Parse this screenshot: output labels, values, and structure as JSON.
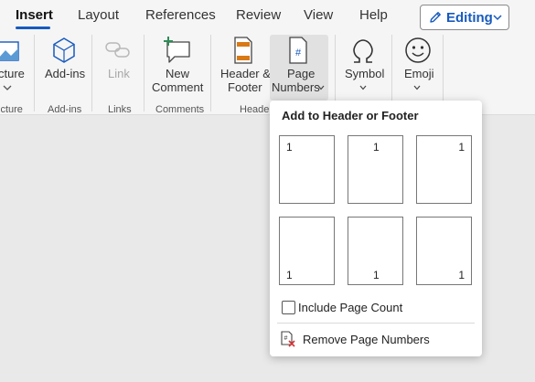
{
  "tabs": [
    {
      "label": "Insert",
      "active": true
    },
    {
      "label": "Layout"
    },
    {
      "label": "References"
    },
    {
      "label": "Review"
    },
    {
      "label": "View"
    },
    {
      "label": "Help"
    }
  ],
  "mode_button": {
    "label": "Editing",
    "icon": "pencil-icon"
  },
  "ribbon": {
    "picture": {
      "label": "cture",
      "group": "icture"
    },
    "addins": {
      "label": "Add-ins",
      "group": "Add-ins"
    },
    "link": {
      "label": "Link",
      "group": "Links",
      "disabled": true
    },
    "comment": {
      "label_line1": "New",
      "label_line2": "Comment",
      "group": "Comments"
    },
    "header_footer": {
      "label_line1": "Header &",
      "label_line2": "Footer",
      "group": "Header"
    },
    "page_numbers": {
      "label_line1": "Page",
      "label_line2": "Numbers"
    },
    "symbol": {
      "label": "Symbol"
    },
    "emoji": {
      "label": "Emoji"
    }
  },
  "dropdown": {
    "title": "Add to Header or Footer",
    "positions": [
      {
        "text": "1",
        "where": "top-left"
      },
      {
        "text": "1",
        "where": "top-center"
      },
      {
        "text": "1",
        "where": "top-right"
      },
      {
        "text": "1",
        "where": "bottom-left"
      },
      {
        "text": "1",
        "where": "bottom-center"
      },
      {
        "text": "1",
        "where": "bottom-right"
      }
    ],
    "include_page_count": {
      "label": "Include Page Count",
      "checked": false
    },
    "remove": {
      "label": "Remove Page Numbers"
    }
  },
  "colors": {
    "accent": "#185abd",
    "link_red": "#d13438",
    "green": "#2e8b57",
    "orange": "#d87a16"
  }
}
